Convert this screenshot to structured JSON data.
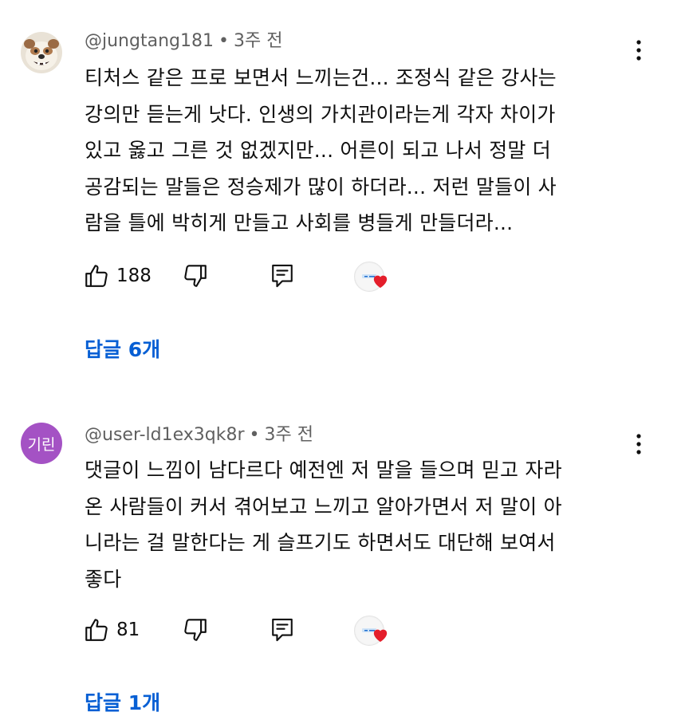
{
  "comments": [
    {
      "author": "@jungtang181",
      "time": "3주 전",
      "avatar_icon": "bulldog-avatar-icon",
      "text": "티처스 같은 프로 보면서 느끼는건... 조정식 같은 강사는\n강의만 듣는게 낫다. 인생의 가치관이라는게 각자 차이가\n있고 옳고 그른 것 없겠지만... 어른이 되고 나서 정말 더\n공감되는 말들은 정승제가 많이 하더라... 저런 말들이 사\n람을 틀에 박히게 만들고 사회를 병들게 만들더라...",
      "likes": "188",
      "replies": "답글 6개"
    },
    {
      "author": "@user-ld1ex3qk8r",
      "time": "3주 전",
      "avatar_letter": "기린",
      "avatar_color": "#a452c4",
      "text": "댓글이 느낌이 남다르다 예전엔 저 말을 들으며 믿고 자라\n온 사람들이 커서 겪어보고 느끼고 알아가면서 저 말이 아\n니라는 걸 말한다는 게 슬프기도 하면서도 대단해 보여서\n좋다",
      "likes": "81",
      "replies": "답글 1개"
    }
  ],
  "colors": {
    "link": "#065fd4",
    "meta": "#606060",
    "heart": "#e41e2b"
  },
  "icons": {
    "like": "thumbs-up-icon",
    "dislike": "thumbs-down-icon",
    "reply": "reply-icon",
    "more": "more-vertical-icon",
    "creator_heart": "creator-heart-icon"
  }
}
